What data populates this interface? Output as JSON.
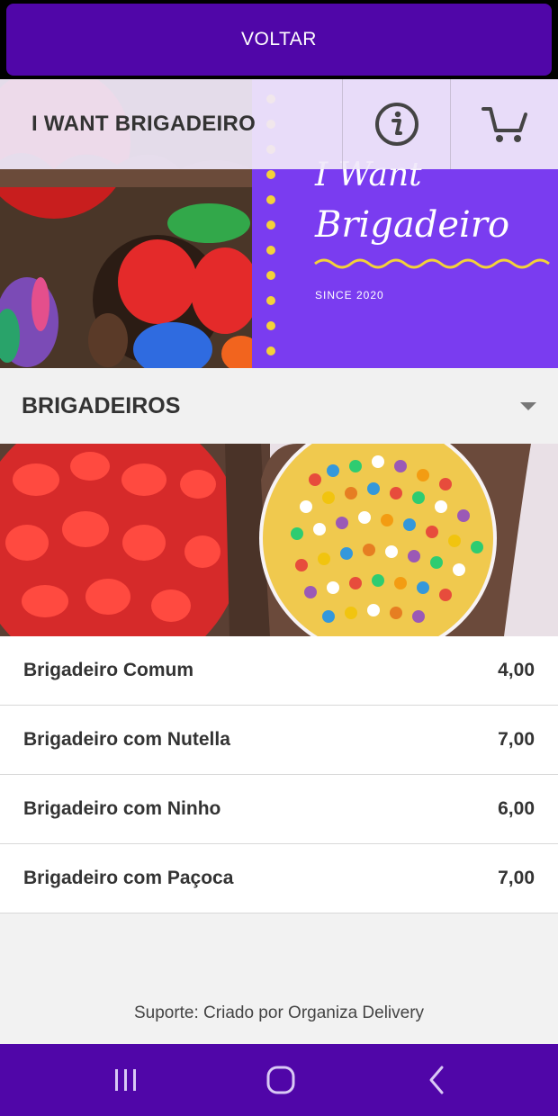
{
  "topbar": {
    "back_label": "VOLTAR"
  },
  "header": {
    "store_name": "I WANT BRIGADEIRO",
    "info_icon": "info-icon",
    "cart_icon": "cart-icon"
  },
  "banner": {
    "logo_line1": "I Want",
    "logo_line2": "Brigadeiro",
    "since": "SINCE 2020"
  },
  "category": {
    "title": "BRIGADEIROS",
    "items": [
      {
        "name": "Brigadeiro Comum",
        "price": "4,00"
      },
      {
        "name": "Brigadeiro com Nutella",
        "price": "7,00"
      },
      {
        "name": "Brigadeiro com Ninho",
        "price": "6,00"
      },
      {
        "name": "Brigadeiro com Paçoca",
        "price": "7,00"
      }
    ]
  },
  "footer": {
    "support_text": "Suporte: Criado por Organiza Delivery"
  },
  "navbar": {
    "icons": [
      "recent-apps-icon",
      "home-icon",
      "back-icon"
    ]
  },
  "colors": {
    "brand_purple": "#5006a8",
    "banner_purple": "#7a3cf0",
    "dots_yellow": "#f4d238"
  }
}
